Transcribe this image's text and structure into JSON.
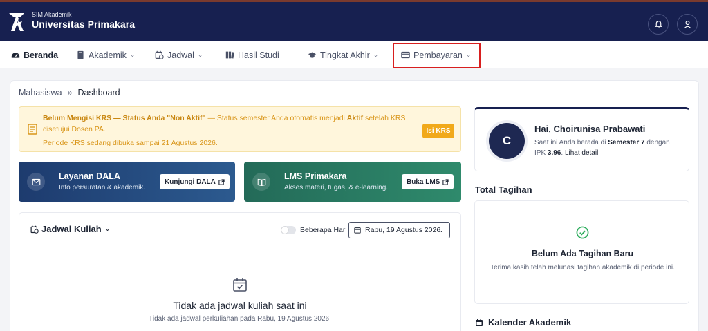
{
  "header": {
    "app_small": "SIM Akademik",
    "app_name": "Universitas Primakara",
    "bell_icon": "bell-icon",
    "user_icon": "user-icon"
  },
  "nav": {
    "items": [
      {
        "label": "Beranda",
        "icon": "dashboard-icon"
      },
      {
        "label": "Akademik",
        "icon": "book-icon"
      },
      {
        "label": "Jadwal",
        "icon": "calendar-clock-icon"
      },
      {
        "label": "Hasil Studi",
        "icon": "books-icon"
      },
      {
        "label": "Tingkat Akhir",
        "icon": "graduation-cap-icon"
      },
      {
        "label": "Pembayaran",
        "icon": "wallet-icon"
      }
    ]
  },
  "breadcrumb": {
    "parent": "Mahasiswa",
    "separator": "»",
    "current": "Dashboard"
  },
  "alert": {
    "bold1": "Belum Mengisi KRS — Status Anda \"Non Aktif\"",
    "text1": " — Status semester Anda otomatis menjadi ",
    "bold2": "Aktif",
    "text2": " setelah KRS disetujui Dosen PA.",
    "line2": "Periode KRS sedang dibuka sampai 21 Agustus 2026.",
    "button": "Isi KRS"
  },
  "promos": {
    "dala": {
      "title": "Layanan DALA",
      "subtitle": "Info persuratan & akademik.",
      "button": "Kunjungi DALA"
    },
    "lms": {
      "title": "LMS Primakara",
      "subtitle": "Akses materi, tugas, & e-learning.",
      "button": "Buka LMS"
    }
  },
  "schedule": {
    "title": "Jadwal Kuliah",
    "toggle_label": "Beberapa Hari",
    "date": "Rabu, 19 Agustus 2026",
    "empty_title": "Tidak ada jadwal kuliah saat ini",
    "empty_sub": "Tidak ada jadwal perkuliahan pada Rabu, 19 Agustus 2026."
  },
  "profile": {
    "initial": "C",
    "greeting": "Hai, Choirunisa Prabawati",
    "info_pre": "Saat ini Anda berada di ",
    "semester": "Semester 7",
    "info_mid": " dengan IPK ",
    "ipk": "3.96",
    "info_post": ". ",
    "link": "Lihat detail"
  },
  "tagihan": {
    "heading": "Total Tagihan",
    "title": "Belum Ada Tagihan Baru",
    "subtitle": "Terima kasih telah melunasi tagihan akademik di periode ini."
  },
  "kalender": {
    "heading": "Kalender Akademik"
  },
  "colors": {
    "navy": "#172050",
    "highlight": "#d81f1f",
    "warning": "#f1a91a",
    "dala": "#1d3b6e",
    "lms": "#236a58"
  }
}
